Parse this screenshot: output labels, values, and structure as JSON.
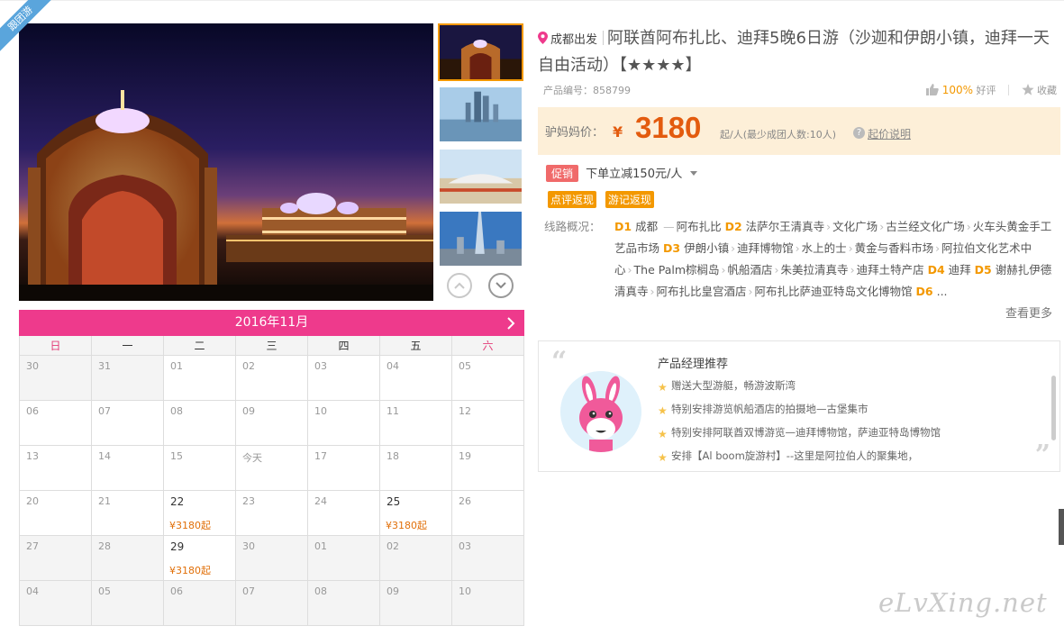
{
  "tag": {
    "label": "跟团游"
  },
  "gallery": {
    "main_image": "abu-dhabi-palace-night",
    "thumbnails": [
      "emirates-palace-night",
      "abu-dhabi-towers",
      "ferrari-world",
      "burj-khalifa-skyline"
    ],
    "active_thumbnail": 0
  },
  "calendar": {
    "month_title": "2016年11月",
    "weekdays": [
      "日",
      "一",
      "二",
      "三",
      "四",
      "五",
      "六"
    ],
    "weeks": [
      [
        {
          "d": "30",
          "type": "other"
        },
        {
          "d": "31",
          "type": "other"
        },
        {
          "d": "01"
        },
        {
          "d": "02"
        },
        {
          "d": "03"
        },
        {
          "d": "04"
        },
        {
          "d": "05"
        }
      ],
      [
        {
          "d": "06"
        },
        {
          "d": "07"
        },
        {
          "d": "08"
        },
        {
          "d": "09"
        },
        {
          "d": "10"
        },
        {
          "d": "11"
        },
        {
          "d": "12"
        }
      ],
      [
        {
          "d": "13"
        },
        {
          "d": "14"
        },
        {
          "d": "15"
        },
        {
          "d": "今天"
        },
        {
          "d": "17"
        },
        {
          "d": "18"
        },
        {
          "d": "19"
        }
      ],
      [
        {
          "d": "20"
        },
        {
          "d": "21"
        },
        {
          "d": "22",
          "price": "¥3180起"
        },
        {
          "d": "23"
        },
        {
          "d": "24"
        },
        {
          "d": "25",
          "price": "¥3180起"
        },
        {
          "d": "26"
        }
      ],
      [
        {
          "d": "27",
          "type": "other"
        },
        {
          "d": "28",
          "type": "other"
        },
        {
          "d": "29",
          "price": "¥3180起"
        },
        {
          "d": "30",
          "type": "other"
        },
        {
          "d": "01",
          "type": "other"
        },
        {
          "d": "02",
          "type": "other"
        },
        {
          "d": "03",
          "type": "other"
        }
      ],
      [
        {
          "d": "04",
          "type": "other"
        },
        {
          "d": "05",
          "type": "other"
        },
        {
          "d": "06",
          "type": "other"
        },
        {
          "d": "07",
          "type": "other"
        },
        {
          "d": "08",
          "type": "other"
        },
        {
          "d": "09",
          "type": "other"
        },
        {
          "d": "10",
          "type": "other"
        }
      ]
    ]
  },
  "product": {
    "depart": "成都出发",
    "title": "阿联酋阿布扎比、迪拜5晚6日游（沙迦和伊朗小镇，迪拜一天自由活动）【★★★★】",
    "code_label": "产品编号：858799",
    "rating_percent": "100%",
    "rating_label": "好评",
    "favorite_label": "收藏"
  },
  "price": {
    "label": "驴妈妈价：",
    "currency": "¥",
    "amount": "3180",
    "unit": "起/人(最少成团人数:10人)",
    "help_label": "起价说明",
    "color": "#e35b0e"
  },
  "promo": {
    "tag": "促销",
    "text": "下单立减150元/人"
  },
  "rebates": [
    "点评返现",
    "游记返现"
  ],
  "route": {
    "label": "线路概况：",
    "days": [
      {
        "day": "D1",
        "stops": [
          "成都",
          "阿布扎比"
        ],
        "lead": "—"
      },
      {
        "day": "D2",
        "stops": [
          "法萨尔王清真寺",
          "文化广场",
          "古兰经文化广场",
          "火车头黄金手工艺品市场"
        ]
      },
      {
        "day": "D3",
        "stops": [
          "伊朗小镇",
          "迪拜博物馆",
          "水上的士",
          "黄金与香料市场",
          "阿拉伯文化艺术中心",
          "The Palm棕榈岛",
          "帆船酒店",
          "朱美拉清真寺",
          "迪拜土特产店"
        ]
      },
      {
        "day": "D4",
        "stops": [
          "迪拜"
        ]
      },
      {
        "day": "D5",
        "stops": [
          "谢赫扎伊德清真寺",
          "阿布扎比皇宫酒店",
          "阿布扎比萨迪亚特岛文化博物馆"
        ]
      },
      {
        "day": "D6",
        "stops": [
          "..."
        ]
      }
    ],
    "see_more": "查看更多"
  },
  "recommend": {
    "title": "产品经理推荐",
    "items": [
      "赠送大型游艇，畅游波斯湾",
      "特别安排游览帆船酒店的拍摄地—古堡集市",
      "特别安排阿联酋双博游览—迪拜博物馆，萨迪亚特岛博物馆",
      "安排【Al boom旋游村】--这里是阿拉伯人的聚集地，"
    ]
  },
  "watermark": "eLvXing.net",
  "colors": {
    "accent_pink": "#ee3a8c",
    "accent_orange": "#f39800",
    "price": "#e35b0e"
  }
}
